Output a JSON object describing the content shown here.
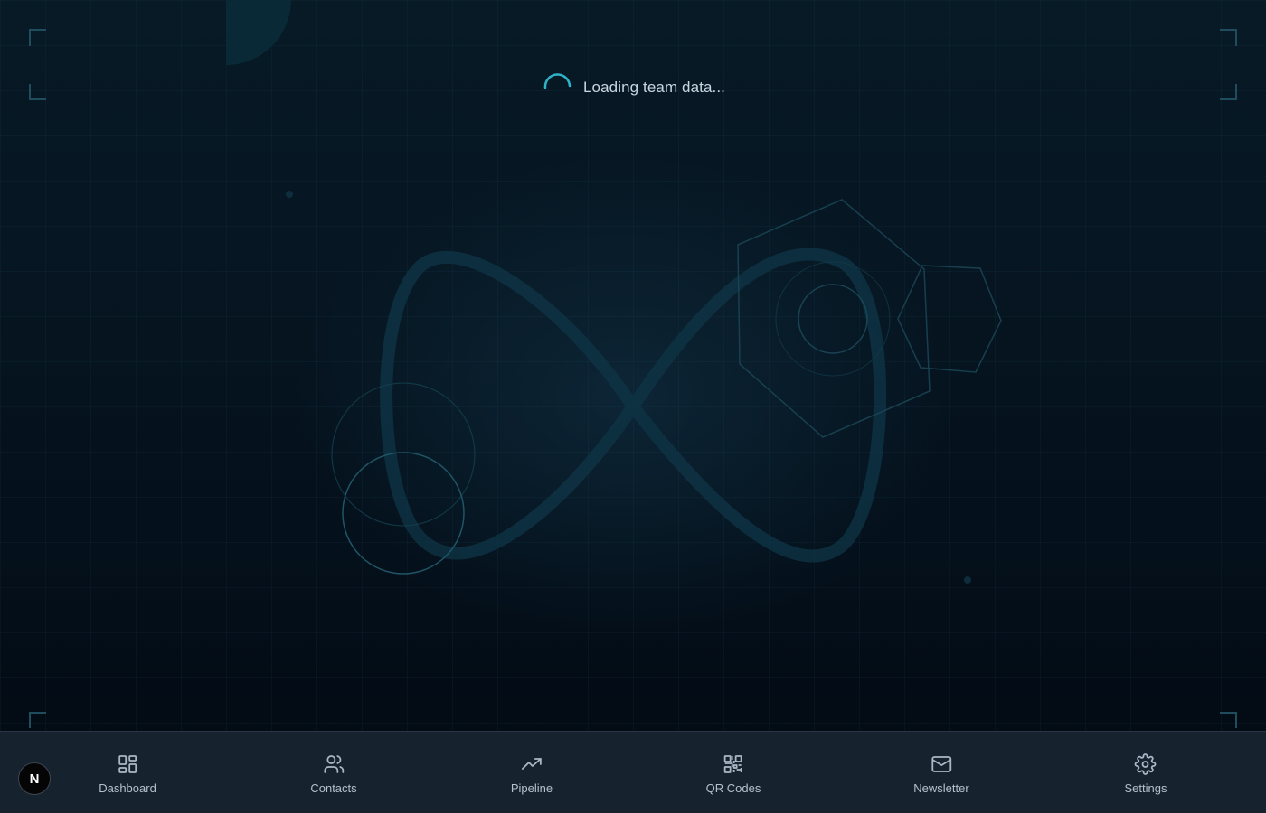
{
  "loading": {
    "text": "Loading team data...",
    "icon": "spinner-icon"
  },
  "logo": {
    "letter": "N"
  },
  "nav": {
    "items": [
      {
        "label": "Dashboard",
        "icon": "dashboard-grid-icon"
      },
      {
        "label": "Contacts",
        "icon": "users-icon"
      },
      {
        "label": "Pipeline",
        "icon": "trending-up-icon"
      },
      {
        "label": "QR Codes",
        "icon": "qr-code-icon"
      },
      {
        "label": "Newsletter",
        "icon": "mail-icon"
      },
      {
        "label": "Settings",
        "icon": "gear-icon"
      }
    ]
  },
  "colors": {
    "accent": "#2fb3c9",
    "background": "#05111c",
    "navbar": "#17222f",
    "nav_text": "#b4c0cc",
    "decor_stroke": "#1d5363"
  }
}
